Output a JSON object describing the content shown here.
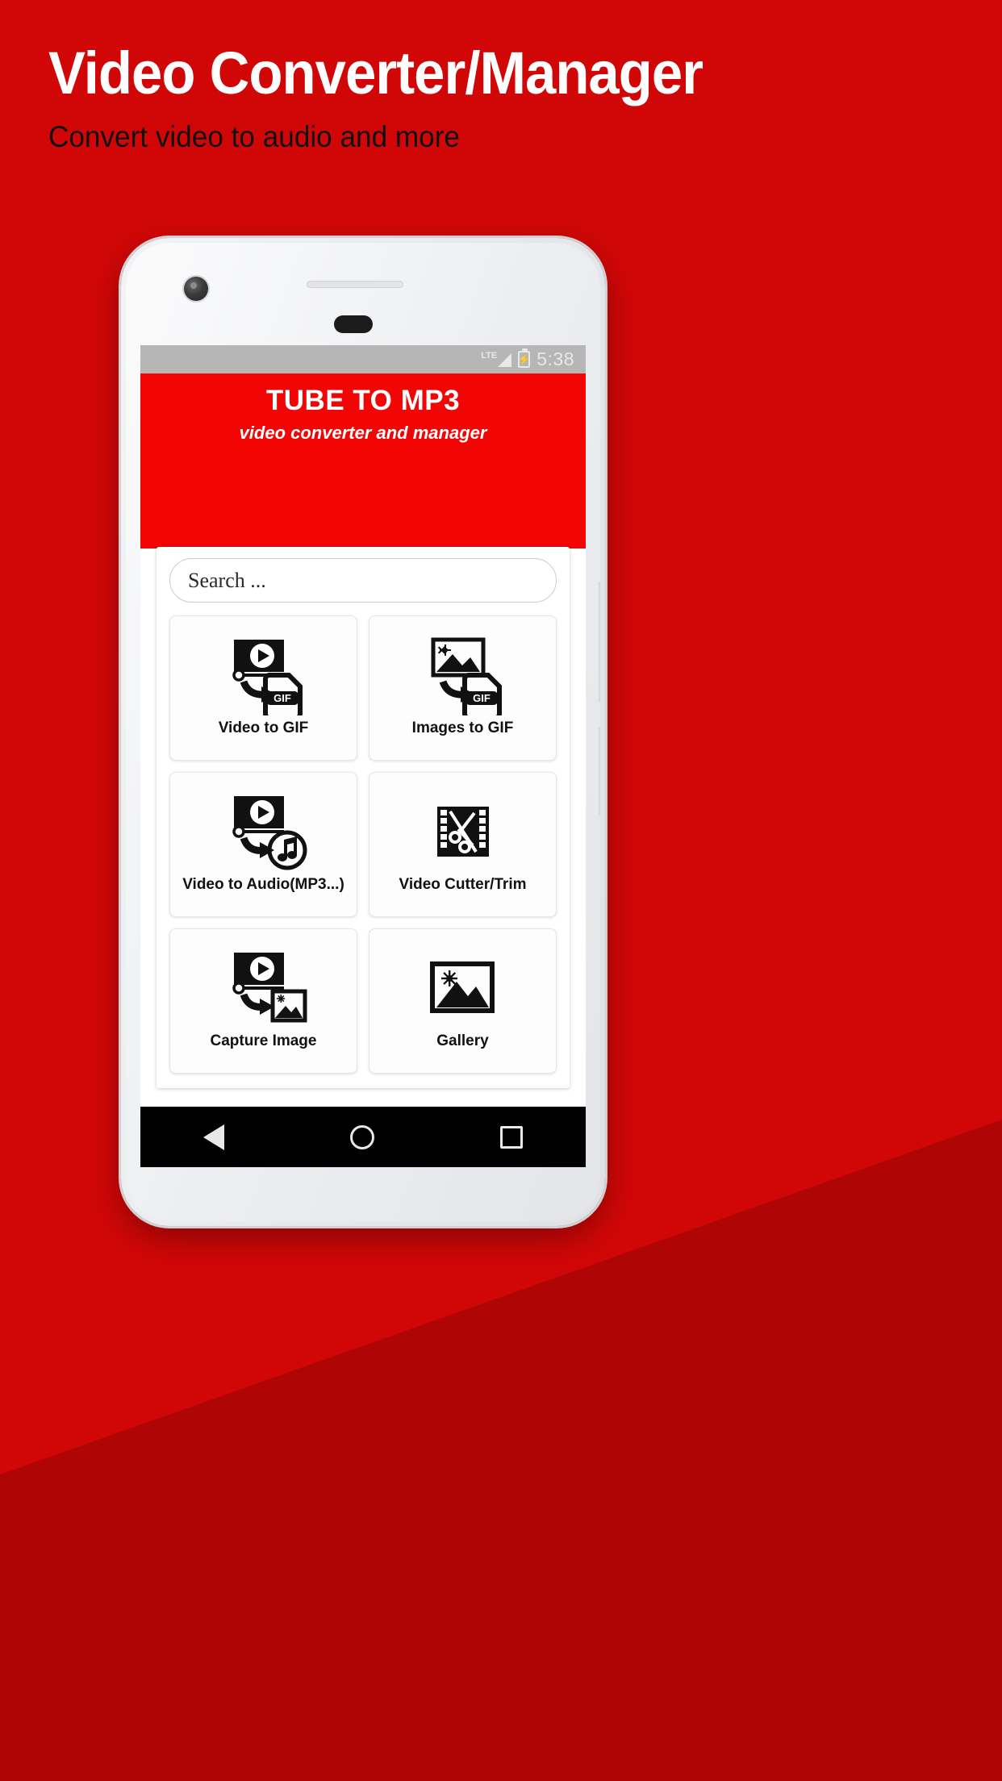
{
  "promo": {
    "title": "Video Converter/Manager",
    "subtitle": "Convert video to audio and more",
    "title_color": "#ffffff",
    "subtitle_color": "#111111",
    "background_color": "#d10707"
  },
  "statusbar": {
    "network_label": "LTE",
    "signal_icon": "signal-bars-icon",
    "battery_icon": "battery-charging-icon",
    "battery_bolt": "⚡",
    "time": "5:38",
    "background_color": "#b6b6b6"
  },
  "app_header": {
    "title": "TUBE TO MP3",
    "subtitle": "video converter and manager",
    "accent_color": "#f20505"
  },
  "search": {
    "placeholder": "Search ...",
    "value": "",
    "icon": "search-icon"
  },
  "grid": {
    "rows": [
      [
        {
          "label": "Video to GIF",
          "icon": "video-to-gif-icon"
        },
        {
          "label": "Images to GIF",
          "icon": "images-to-gif-icon"
        }
      ],
      [
        {
          "label": "Video to Audio(MP3...)",
          "icon": "video-to-audio-icon"
        },
        {
          "label": "Video Cutter/Trim",
          "icon": "film-scissors-icon"
        }
      ],
      [
        {
          "label": "Capture Image",
          "icon": "video-to-image-icon"
        },
        {
          "label": "Gallery",
          "icon": "gallery-image-icon"
        }
      ]
    ]
  },
  "navbar": {
    "back_label": "Back",
    "home_label": "Home",
    "recents_label": "Recents",
    "back_icon": "triangle-back-icon",
    "home_icon": "circle-home-icon",
    "recents_icon": "square-recents-icon"
  }
}
